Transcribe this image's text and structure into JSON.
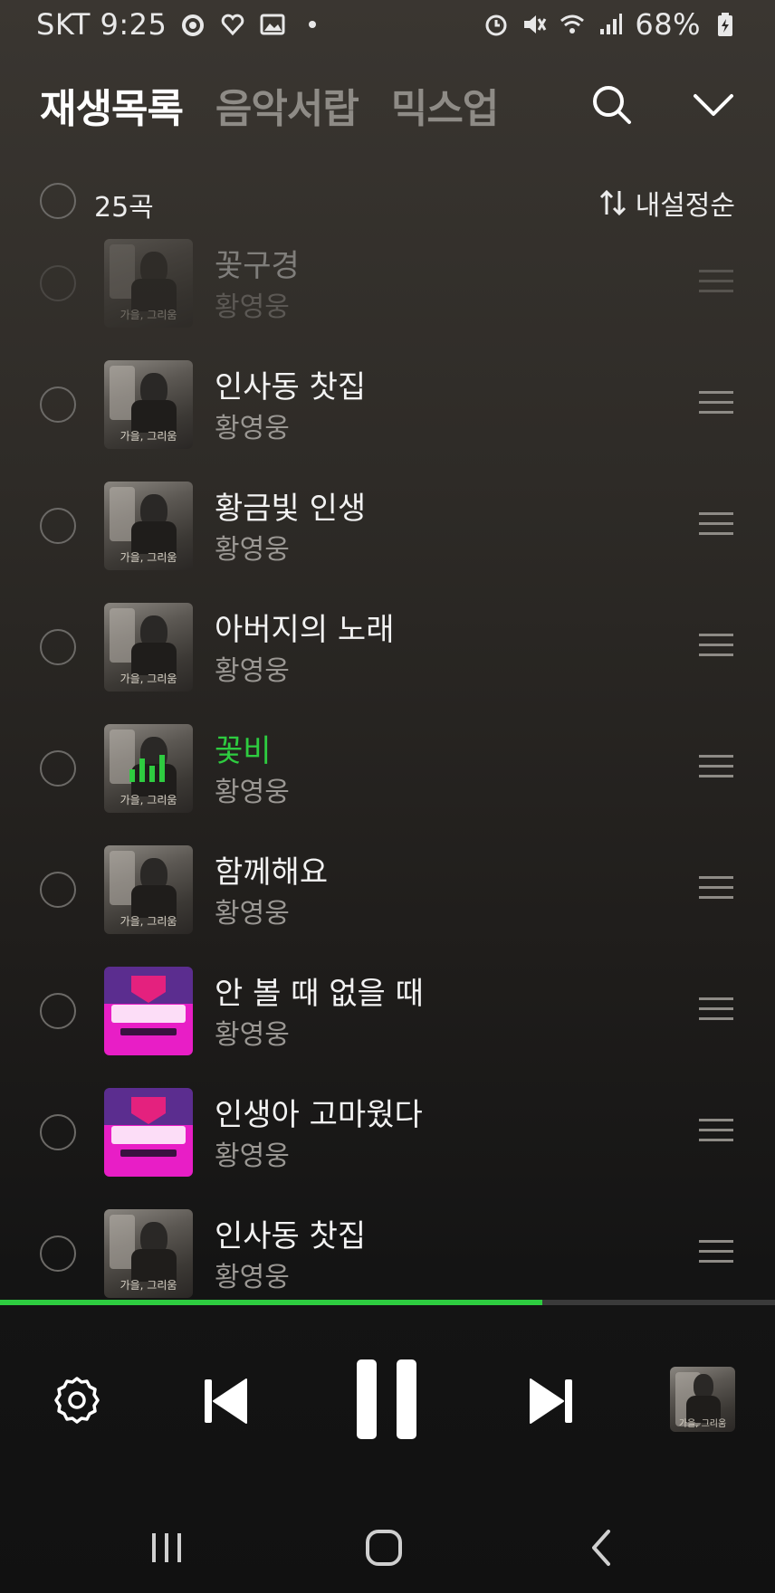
{
  "status_bar": {
    "carrier_time": "SKT 9:25",
    "battery": "68%",
    "icons": [
      "moon-dot-icon",
      "heart-icon",
      "image-icon",
      "dot-icon",
      "alarm-icon",
      "mute-icon",
      "wifi-icon",
      "signal-icon",
      "battery-icon"
    ]
  },
  "header": {
    "tabs": [
      {
        "label": "재생목록",
        "active": true
      },
      {
        "label": "음악서랍",
        "active": false
      },
      {
        "label": "믹스업",
        "active": false
      }
    ]
  },
  "list_header": {
    "count": "25곡",
    "sort_label": "내설정순"
  },
  "songs": [
    {
      "title": "꽃구경",
      "artist": "황영웅",
      "art": "album",
      "state": "faded"
    },
    {
      "title": "인사동 찻집",
      "artist": "황영웅",
      "art": "album",
      "state": "normal"
    },
    {
      "title": "황금빛 인생",
      "artist": "황영웅",
      "art": "album",
      "state": "normal"
    },
    {
      "title": "아버지의 노래",
      "artist": "황영웅",
      "art": "album",
      "state": "normal"
    },
    {
      "title": "꽃비",
      "artist": "황영웅",
      "art": "album",
      "state": "playing"
    },
    {
      "title": "함께해요",
      "artist": "황영웅",
      "art": "album",
      "state": "normal"
    },
    {
      "title": "안 볼 때 없을 때",
      "artist": "황영웅",
      "art": "show",
      "state": "normal"
    },
    {
      "title": "인생아 고마웠다",
      "artist": "황영웅",
      "art": "show",
      "state": "normal"
    },
    {
      "title": "인사동 찻집",
      "artist": "황영웅",
      "art": "album",
      "state": "normal"
    }
  ],
  "album_caption": "가을, 그리움",
  "progress": 0.7,
  "colors": {
    "accent": "#2ecc40",
    "show_purple": "#5b2d8f",
    "show_pink": "#e81ec6"
  }
}
